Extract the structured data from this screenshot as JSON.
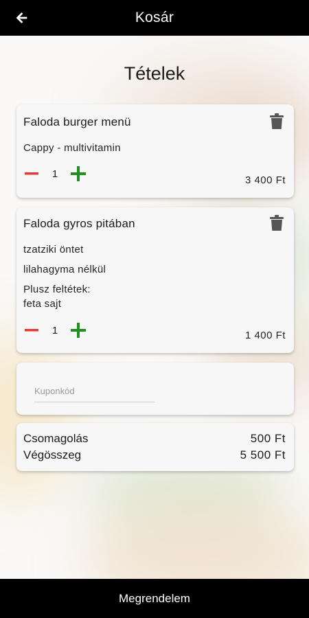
{
  "header": {
    "title": "Kosár",
    "back_icon": "arrow-left-icon"
  },
  "page_title": "Tételek",
  "items": [
    {
      "name": "Faloda burger menü",
      "options": [
        "Cappy - multivitamin"
      ],
      "quantity": "1",
      "price": "3 400 Ft"
    },
    {
      "name": "Faloda gyros pitában",
      "options": [
        "tzatziki öntet",
        "lilahagyma nélkül",
        "Plusz feltétek:",
        "feta sajt"
      ],
      "quantity": "1",
      "price": "1 400 Ft"
    }
  ],
  "coupon": {
    "placeholder": "Kuponkód",
    "value": ""
  },
  "summary": {
    "packaging_label": "Csomagolás",
    "packaging_value": "500 Ft",
    "total_label": "Végösszeg",
    "total_value": "5 500 Ft"
  },
  "footer": {
    "order_label": "Megrendelem"
  },
  "colors": {
    "minus": "#e53935",
    "plus": "#1f8f1f",
    "trash": "#555555",
    "bar": "#000000"
  }
}
